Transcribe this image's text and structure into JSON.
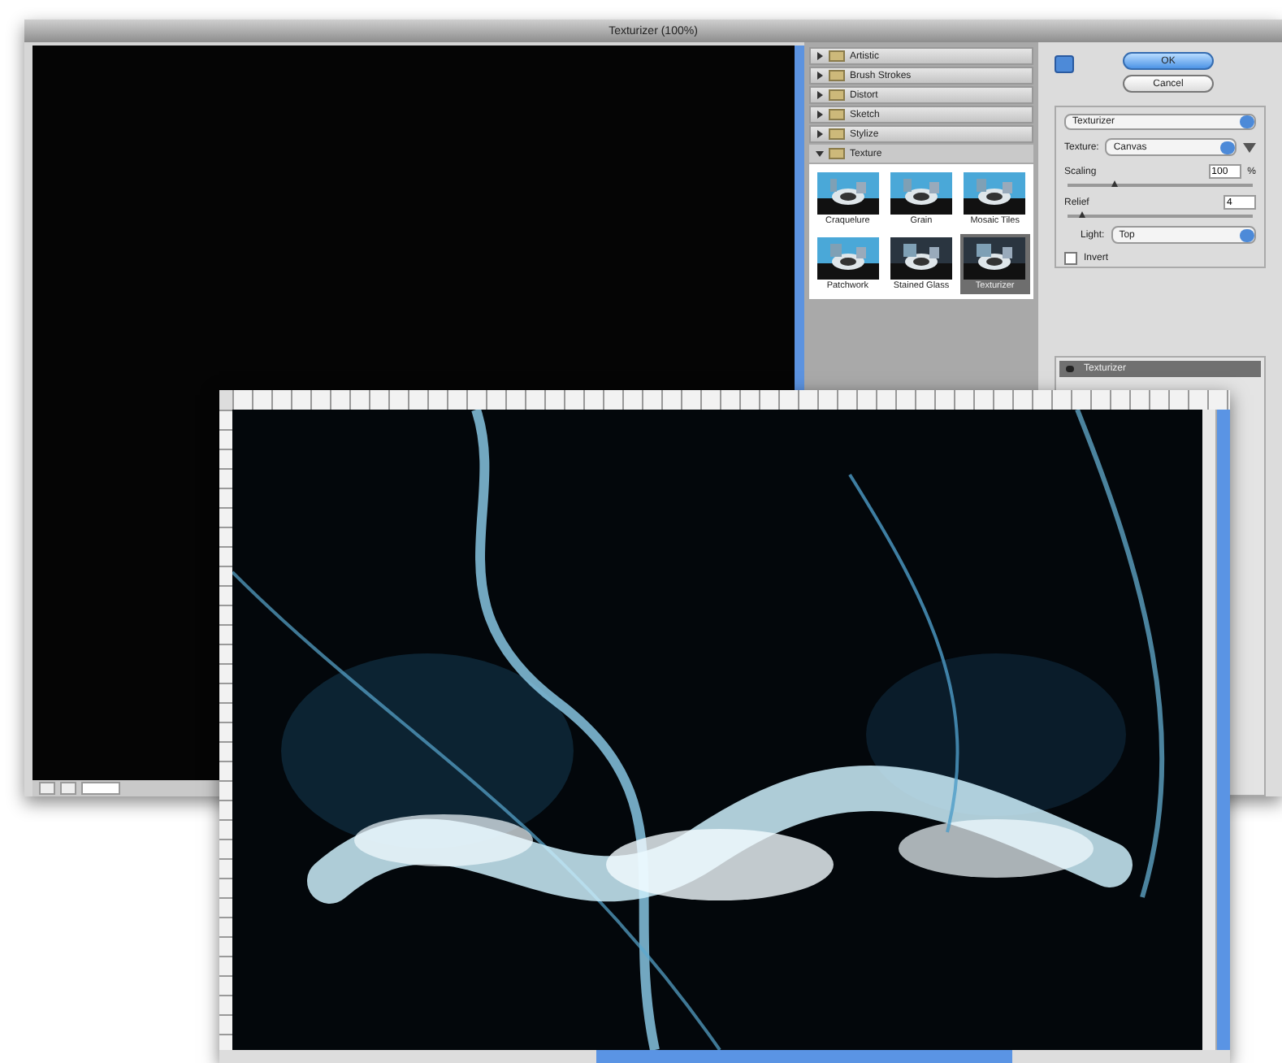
{
  "window": {
    "title": "Texturizer (100%)"
  },
  "categories": [
    {
      "label": "Artistic",
      "expanded": false
    },
    {
      "label": "Brush Strokes",
      "expanded": false
    },
    {
      "label": "Distort",
      "expanded": false
    },
    {
      "label": "Sketch",
      "expanded": false
    },
    {
      "label": "Stylize",
      "expanded": false
    },
    {
      "label": "Texture",
      "expanded": true
    }
  ],
  "filters": [
    {
      "label": "Craquelure",
      "selected": false
    },
    {
      "label": "Grain",
      "selected": false
    },
    {
      "label": "Mosaic Tiles",
      "selected": false
    },
    {
      "label": "Patchwork",
      "selected": false
    },
    {
      "label": "Stained Glass",
      "selected": false
    },
    {
      "label": "Texturizer",
      "selected": true
    }
  ],
  "buttons": {
    "ok": "OK",
    "cancel": "Cancel"
  },
  "filter_select": "Texturizer",
  "options": {
    "texture": {
      "label": "Texture:",
      "value": "Canvas"
    },
    "scaling": {
      "label": "Scaling",
      "value": "100",
      "unit": "%",
      "level": 0.25
    },
    "relief": {
      "label": "Relief",
      "value": "4",
      "level": 0.08
    },
    "light": {
      "label": "Light:",
      "value": "Top"
    },
    "invert": {
      "label": "Invert",
      "checked": false
    }
  },
  "effect_layers": [
    {
      "label": "Texturizer",
      "selected": true
    }
  ]
}
